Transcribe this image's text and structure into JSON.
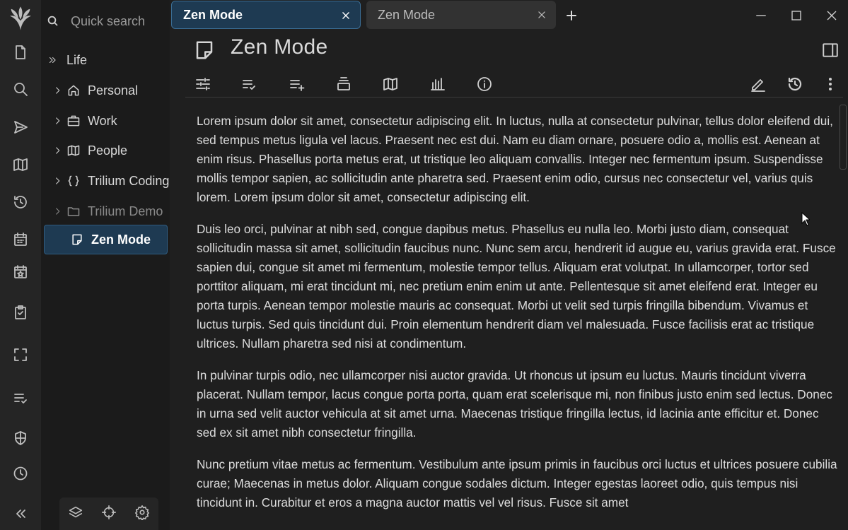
{
  "tabs": [
    {
      "title": "Zen Mode",
      "active": true
    },
    {
      "title": "Zen Mode",
      "active": false
    }
  ],
  "search": {
    "placeholder": "Quick search"
  },
  "tree": {
    "root": "Life",
    "items": [
      {
        "label": "Personal",
        "icon": "home-icon"
      },
      {
        "label": "Work",
        "icon": "briefcase-icon"
      },
      {
        "label": "People",
        "icon": "map-icon"
      },
      {
        "label": "Trilium Coding",
        "icon": "braces-icon"
      },
      {
        "label": "Trilium Demo",
        "icon": "folder-icon"
      },
      {
        "label": "Zen Mode",
        "icon": "note-icon"
      }
    ]
  },
  "note": {
    "title": "Zen Mode",
    "paragraphs": [
      "Lorem ipsum dolor sit amet, consectetur adipiscing elit. In luctus, nulla at consectetur pulvinar, tellus dolor eleifend dui, sed tempus metus ligula vel lacus. Praesent nec est dui. Nam eu diam ornare, posuere odio a, mollis est. Aenean at enim risus. Phasellus porta metus erat, ut tristique leo aliquam convallis. Integer nec fermentum ipsum. Suspendisse mollis tempor sapien, ac sollicitudin ante pharetra sed. Praesent enim odio, cursus nec consectetur vel, varius quis lorem. Lorem ipsum dolor sit amet, consectetur adipiscing elit.",
      "Duis leo orci, pulvinar at nibh sed, congue dapibus metus. Phasellus eu nulla leo. Morbi justo diam, consequat sollicitudin massa sit amet, sollicitudin faucibus nunc. Nunc sem arcu, hendrerit id augue eu, varius gravida erat. Fusce sapien dui, congue sit amet mi fermentum, molestie tempor tellus. Aliquam erat volutpat. In ullamcorper, tortor sed porttitor aliquam, mi erat tincidunt mi, nec pretium enim enim ut ante. Pellentesque sit amet eleifend erat. Integer eu porta turpis. Aenean tempor molestie mauris ac consequat. Morbi ut velit sed turpis fringilla bibendum. Vivamus et luctus turpis. Sed quis tincidunt dui. Proin elementum hendrerit diam vel malesuada. Fusce facilisis erat ac tristique ultrices. Nullam pharetra sed nisi at condimentum.",
      "In pulvinar turpis odio, nec ullamcorper nisi auctor gravida. Ut rhoncus ut ipsum eu luctus. Mauris tincidunt viverra placerat. Nullam tempor, lacus congue porta porta, quam erat scelerisque mi, non finibus justo enim sed lectus. Donec in urna sed velit auctor vehicula at sit amet urna. Maecenas tristique fringilla lectus, id lacinia ante efficitur et. Donec sed ex sit amet nibh consectetur fringilla.",
      "Nunc pretium vitae metus ac fermentum. Vestibulum ante ipsum primis in faucibus orci luctus et ultrices posuere cubilia curae; Maecenas in metus dolor. Aliquam congue sodales dictum. Integer egestas laoreet odio, quis tempus nisi tincidunt in. Curabitur et eros a magna auctor mattis vel vel risus. Fusce sit amet"
    ]
  },
  "colors": {
    "accent": "#1e3a52",
    "background": "#1f1f1f",
    "sidebar": "#252525"
  }
}
